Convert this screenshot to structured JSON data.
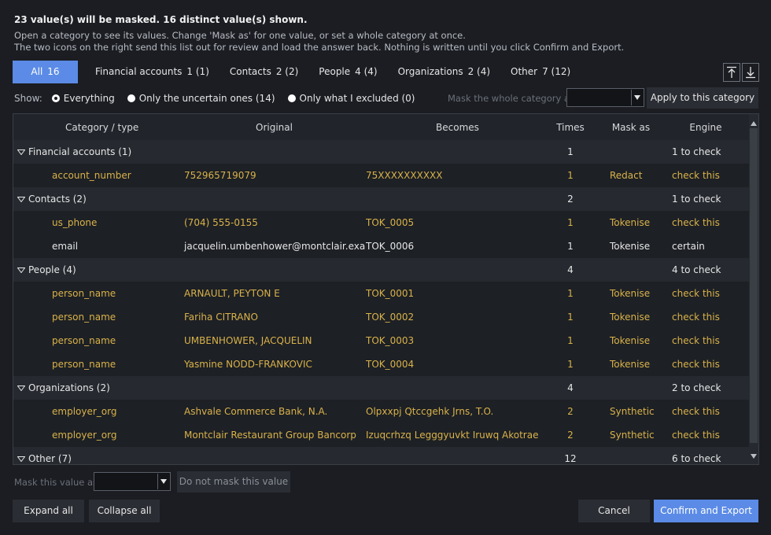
{
  "header": {
    "summary": "23 value(s) will be masked. 16 distinct value(s) shown.",
    "line1": "Open a category to see its values. Change 'Mask as' for one value, or set a whole category at once.",
    "line2": "The two icons on the right send this list out for review and load the answer back. Nothing is written until you click Confirm and Export."
  },
  "tabs": [
    {
      "label": "All",
      "count": "16"
    },
    {
      "label": "Financial accounts",
      "count": "1 (1)"
    },
    {
      "label": "Contacts",
      "count": "2 (2)"
    },
    {
      "label": "People",
      "count": "4 (4)"
    },
    {
      "label": "Organizations",
      "count": "2 (4)"
    },
    {
      "label": "Other",
      "count": "7 (12)"
    }
  ],
  "icons": {
    "export": "upload-icon",
    "import": "download-icon"
  },
  "filter": {
    "show_label": "Show:",
    "options": [
      "Everything",
      "Only the uncertain ones (14)",
      "Only what I excluded (0)"
    ],
    "selected": 0
  },
  "category_mask": {
    "label": "Mask the whole category as:",
    "value": "",
    "apply_label": "Apply to this category"
  },
  "table": {
    "columns": [
      "Category / type",
      "Original",
      "Becomes",
      "Times",
      "Mask as",
      "Engine"
    ],
    "rows": [
      {
        "kind": "cat",
        "label": "Financial accounts  (1)",
        "times": "1",
        "engine": "1 to check"
      },
      {
        "kind": "item",
        "type": "account_number",
        "original": "752965719079",
        "becomes": "75XXXXXXXXXX",
        "times": "1",
        "mask": "Redact",
        "engine": "check this",
        "uncertain": true
      },
      {
        "kind": "cat",
        "label": "Contacts  (2)",
        "times": "2",
        "engine": "1 to check"
      },
      {
        "kind": "item",
        "type": "us_phone",
        "original": "(704) 555-0155",
        "becomes": "TOK_0005",
        "times": "1",
        "mask": "Tokenise",
        "engine": "check this",
        "uncertain": true
      },
      {
        "kind": "item",
        "type": "email",
        "original": "jacquelin.umbenhower@montclair.exampl",
        "becomes": "TOK_0006",
        "times": "1",
        "mask": "Tokenise",
        "engine": "certain",
        "uncertain": false
      },
      {
        "kind": "cat",
        "label": "People  (4)",
        "times": "4",
        "engine": "4 to check"
      },
      {
        "kind": "item",
        "type": "person_name",
        "original": "ARNAULT, PEYTON E",
        "becomes": "TOK_0001",
        "times": "1",
        "mask": "Tokenise",
        "engine": "check this",
        "uncertain": true
      },
      {
        "kind": "item",
        "type": "person_name",
        "original": "Fariha CITRANO",
        "becomes": "TOK_0002",
        "times": "1",
        "mask": "Tokenise",
        "engine": "check this",
        "uncertain": true
      },
      {
        "kind": "item",
        "type": "person_name",
        "original": "UMBENHOWER, JACQUELIN",
        "becomes": "TOK_0003",
        "times": "1",
        "mask": "Tokenise",
        "engine": "check this",
        "uncertain": true
      },
      {
        "kind": "item",
        "type": "person_name",
        "original": "Yasmine NODD-FRANKOVIC",
        "becomes": "TOK_0004",
        "times": "1",
        "mask": "Tokenise",
        "engine": "check this",
        "uncertain": true
      },
      {
        "kind": "cat",
        "label": "Organizations  (2)",
        "times": "4",
        "engine": "2 to check"
      },
      {
        "kind": "item",
        "type": "employer_org",
        "original": "Ashvale Commerce Bank, N.A.",
        "becomes": "Olpxxpj Qtccgehk Jrns, T.O.",
        "times": "2",
        "mask": "Synthetic",
        "engine": "check this",
        "uncertain": true
      },
      {
        "kind": "item",
        "type": "employer_org",
        "original": "Montclair Restaurant Group Bancorp",
        "becomes": "Izuqcrhzq Legggyuvkt Iruwq Akotrae",
        "times": "2",
        "mask": "Synthetic",
        "engine": "check this",
        "uncertain": true
      },
      {
        "kind": "cat",
        "label": "Other  (7)",
        "times": "12",
        "engine": "6 to check"
      }
    ]
  },
  "value_mask": {
    "label": "Mask this value as",
    "value": "",
    "dont_mask_label": "Do not mask this value"
  },
  "footer": {
    "expand_all": "Expand all",
    "collapse_all": "Collapse all",
    "cancel": "Cancel",
    "confirm": "Confirm and Export"
  },
  "colors": {
    "accent": "#5b8be6",
    "uncertain": "#d9b24a",
    "background": "#1b1d22"
  }
}
